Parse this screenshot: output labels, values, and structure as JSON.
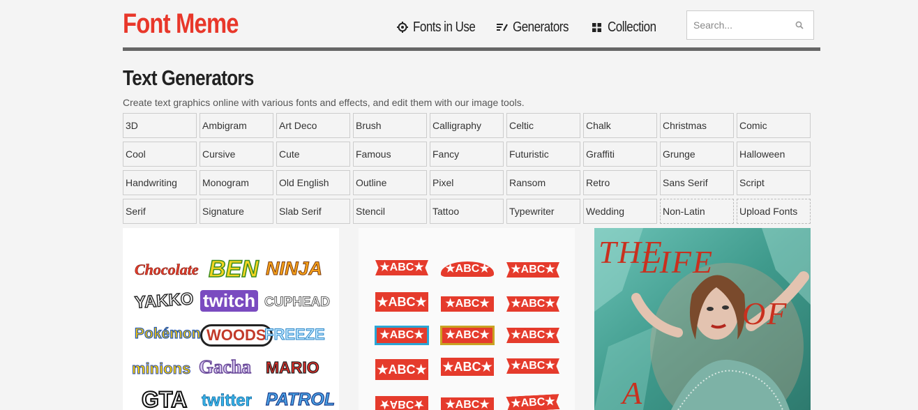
{
  "site": {
    "logo": "Font Meme"
  },
  "nav": [
    {
      "label": "Fonts in Use",
      "icon": "crosshair-icon"
    },
    {
      "label": "Generators",
      "icon": "pen-list-icon"
    },
    {
      "label": "Collection",
      "icon": "grid-icon"
    }
  ],
  "search": {
    "placeholder": "Search...",
    "icon": "search-icon"
  },
  "page": {
    "title": "Text Generators",
    "intro": "Create text graphics online with various fonts and effects, and edit them with our image tools."
  },
  "categories": [
    "3D",
    "Ambigram",
    "Art Deco",
    "Brush",
    "Calligraphy",
    "Celtic",
    "Chalk",
    "Christmas",
    "Comic",
    "Cool",
    "Cursive",
    "Cute",
    "Famous",
    "Fancy",
    "Futuristic",
    "Graffiti",
    "Grunge",
    "Halloween",
    "Handwriting",
    "Monogram",
    "Old English",
    "Outline",
    "Pixel",
    "Ransom",
    "Retro",
    "Sans Serif",
    "Script",
    "Serif",
    "Signature",
    "Slab Serif",
    "Stencil",
    "Tattoo",
    "Typewriter",
    "Wedding",
    "Non-Latin",
    "Upload Fonts"
  ],
  "logo_samples": [
    "Chocolate",
    "BEN",
    "NINJA",
    "YAKKO",
    "twitch",
    "CUPHEAD",
    "Pokémon",
    "WOODS",
    "FREEZE",
    "minions",
    "Gacha",
    "MARIO",
    "GTA",
    "twitter",
    "PATROL"
  ],
  "banner_text": "★ABC★",
  "poster_text": [
    "THE",
    "LIFE",
    "OF",
    "A"
  ],
  "colors": {
    "brand": "#e8372a",
    "rule": "#666666",
    "banner": "#e53b2c"
  }
}
